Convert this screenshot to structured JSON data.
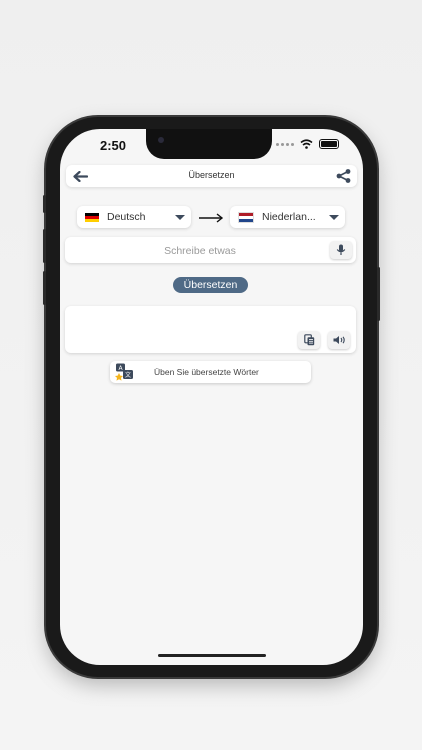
{
  "status": {
    "time": "2:50"
  },
  "header": {
    "title": "Übersetzen"
  },
  "source_language": {
    "name": "Deutsch",
    "flag_colors": [
      "#000000",
      "#dd0000",
      "#ffce00"
    ]
  },
  "target_language": {
    "name": "Niederlan...",
    "flag_colors": [
      "#ae1c28",
      "#ffffff",
      "#21468b"
    ]
  },
  "input": {
    "placeholder": "Schreibe etwas",
    "value": ""
  },
  "translate_button": {
    "label": "Übersetzen"
  },
  "output": {
    "text": ""
  },
  "practice": {
    "label": "Üben Sie übersetzte Wörter"
  },
  "icons": {
    "back": "arrow-left-icon",
    "share": "share-icon",
    "swap": "arrow-right-icon",
    "mic": "microphone-icon",
    "copy": "copy-icon",
    "speaker": "speaker-icon",
    "practice": "translate-practice-icon"
  },
  "colors": {
    "accent": "#4f6a86",
    "icon": "#3d4a5c"
  }
}
